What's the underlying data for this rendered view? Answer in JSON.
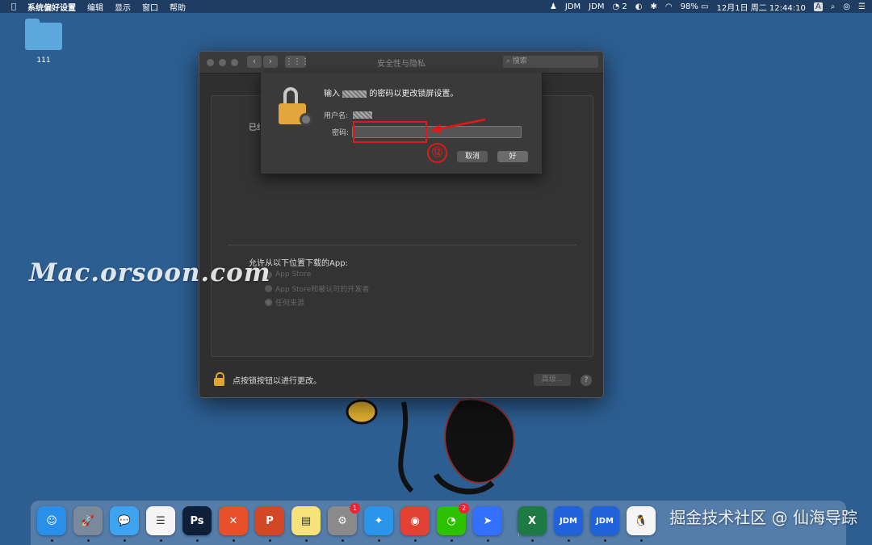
{
  "menubar": {
    "app_name": "系统偏好设置",
    "menus": [
      "编辑",
      "显示",
      "窗口",
      "帮助"
    ],
    "status": {
      "jdm1": "JDM",
      "jdm2": "JDM",
      "wechat_count": "2",
      "battery": "98%",
      "clock": "12月1日 周二  12:44:10",
      "input_method": "A"
    }
  },
  "desktop": {
    "folder_label": "111"
  },
  "window": {
    "title": "安全性与隐私",
    "search_placeholder": "搜索",
    "already_label": "已经",
    "allow_label": "允许从以下位置下载的App:",
    "radio_options": [
      "App Store",
      "App Store和被认可的开发者",
      "任何来源"
    ],
    "selected_option_index": 2,
    "lock_text": "点按锁按钮以进行更改。",
    "advanced_label": "高级...",
    "help_label": "?"
  },
  "sheet": {
    "message_prefix": "输入",
    "message_suffix": "的密码以更改锁屏设置。",
    "username_label": "用户名:",
    "password_label": "密码:",
    "password_value": "",
    "cancel_label": "取消",
    "ok_label": "好"
  },
  "annotation": {
    "step_number": "⑫",
    "highlight_color": "#e01818"
  },
  "watermark": {
    "text": "Mac.orsoon.com",
    "text2": "掘金技术社区 @ 仙海导踪"
  },
  "dock": {
    "apps": [
      {
        "name": "Finder",
        "glyph": "☺",
        "color": "#2a8fe8"
      },
      {
        "name": "Launchpad",
        "glyph": "🚀",
        "color": "#7a8a9a"
      },
      {
        "name": "Messages",
        "glyph": "💬",
        "color": "#3ea3f0"
      },
      {
        "name": "Reminders",
        "glyph": "☰",
        "color": "#f4f4f4"
      },
      {
        "name": "Photoshop",
        "glyph": "Ps",
        "color": "#0e1f3a"
      },
      {
        "name": "XMind",
        "glyph": "✕",
        "color": "#e8502a"
      },
      {
        "name": "PowerPoint",
        "glyph": "P",
        "color": "#d24726"
      },
      {
        "name": "Notes",
        "glyph": "▤",
        "color": "#f7e37a"
      },
      {
        "name": "System Preferences",
        "glyph": "⚙",
        "color": "#8a8a8a",
        "badge": "1"
      },
      {
        "name": "Safari",
        "glyph": "✦",
        "color": "#2b95ec"
      },
      {
        "name": "Chrome",
        "glyph": "◉",
        "color": "#e34133"
      },
      {
        "name": "WeChat",
        "glyph": "◔",
        "color": "#2dc100",
        "badge": "2"
      },
      {
        "name": "Feishu",
        "glyph": "➤",
        "color": "#3370ff"
      },
      {
        "name": "Excel",
        "glyph": "X",
        "color": "#1d7a45"
      },
      {
        "name": "JDM 1",
        "glyph": "JDM",
        "color": "#1f62d9"
      },
      {
        "name": "JDM 2",
        "glyph": "JDM",
        "color": "#1f62d9"
      },
      {
        "name": "QQ",
        "glyph": "🐧",
        "color": "#f5f5f5"
      }
    ]
  }
}
